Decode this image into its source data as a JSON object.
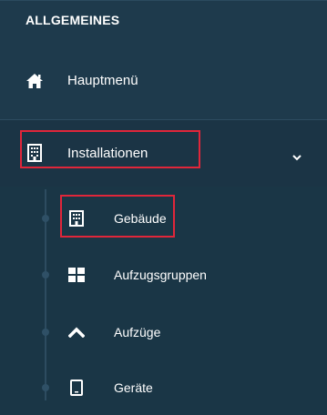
{
  "sidebar": {
    "section_title": "ALLGEMEINES",
    "items": [
      {
        "label": "Hauptmenü",
        "icon": "home-icon"
      },
      {
        "label": "Installationen",
        "icon": "building-icon",
        "expanded": true
      }
    ],
    "subitems": [
      {
        "label": "Gebäude",
        "icon": "building-icon"
      },
      {
        "label": "Aufzugsgruppen",
        "icon": "grid-icon"
      },
      {
        "label": "Aufzüge",
        "icon": "chevron-up-icon"
      },
      {
        "label": "Geräte",
        "icon": "tablet-icon"
      }
    ]
  },
  "colors": {
    "background": "#1e3a4c",
    "highlight": "#e0263a",
    "text": "#ffffff"
  }
}
